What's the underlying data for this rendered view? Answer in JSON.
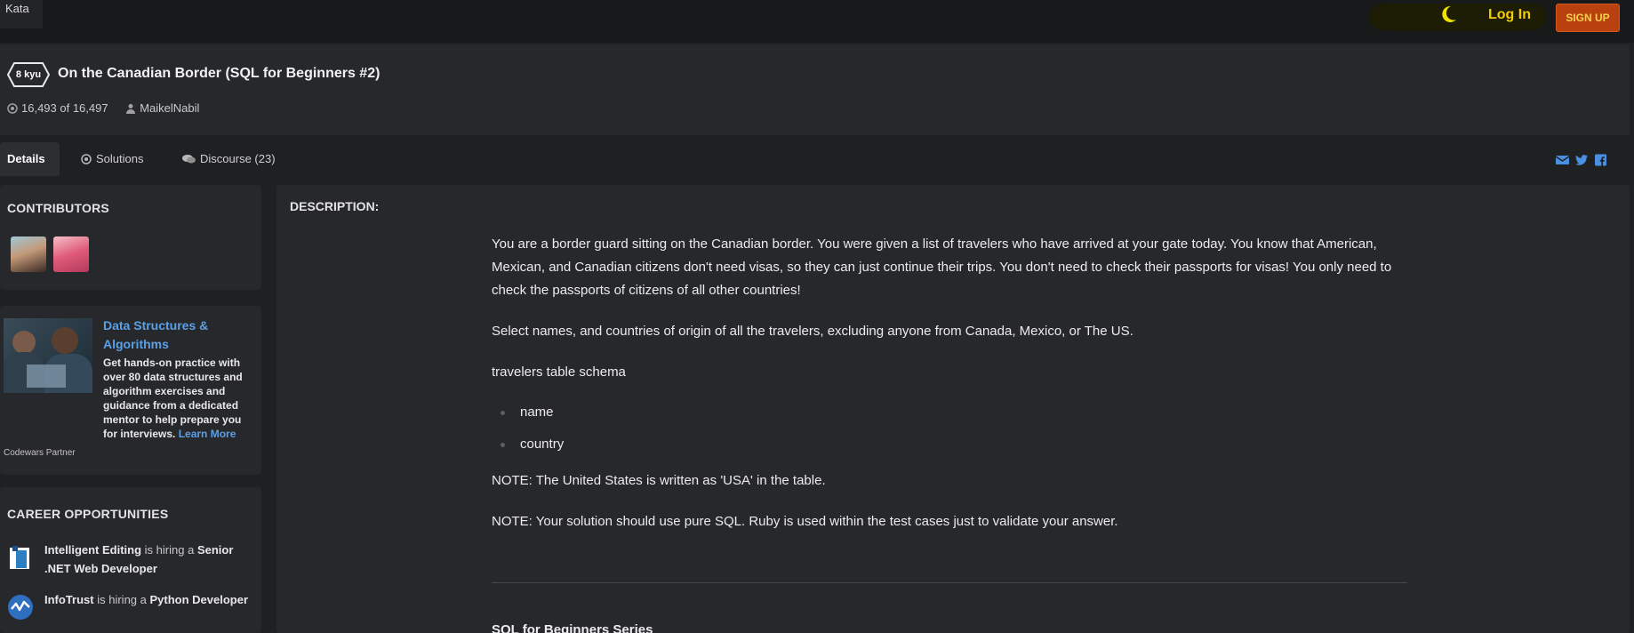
{
  "topbar": {
    "section_tab": "Kata",
    "login_label": "Log In",
    "signup_label": "SIGN UP",
    "accent_yellow": "#f2cd00",
    "signup_bg": "#b8410f"
  },
  "kata": {
    "rank": "8 kyu",
    "title": "On the Canadian Border (SQL for Beginners #2)",
    "stats": "16,493 of 16,497",
    "author": "MaikelNabil"
  },
  "tabs": {
    "details": "Details",
    "solutions": "Solutions",
    "discourse": "Discourse (23)"
  },
  "sidebar": {
    "contributors_heading": "CONTRIBUTORS",
    "ad": {
      "title": "Data Structures & Algorithms",
      "text": "Get hands-on practice with over 80 data structures and algorithm exercises and guidance from a dedicated mentor to help prepare you for interviews.",
      "learn_more": "Learn More",
      "partner": "Codewars Partner"
    },
    "careers_heading": "CAREER OPPORTUNITIES",
    "jobs": [
      {
        "company": "Intelligent Editing",
        "hiring": "is hiring a",
        "role": "Senior .NET Web Developer"
      },
      {
        "company": "InfoTrust",
        "hiring": "is hiring a",
        "role": "Python Developer"
      }
    ]
  },
  "description": {
    "heading": "DESCRIPTION:",
    "p1": "You are a border guard sitting on the Canadian border. You were given a list of travelers who have arrived at your gate today. You know that American, Mexican, and Canadian citizens don't need visas, so they can just continue their trips. You don't need to check their passports for visas! You only need to check the passports of citizens of all other countries!",
    "p2": "Select names, and countries of origin of all the travelers, excluding anyone from Canada, Mexico, or The US.",
    "p3": "travelers table schema",
    "columns": [
      "name",
      "country"
    ],
    "note1": "NOTE: The United States is written as 'USA' in the table.",
    "note2": "NOTE: Your solution should use pure SQL. Ruby is used within the test cases just to validate your answer.",
    "cut_heading": "SQL for Beginners Series"
  }
}
